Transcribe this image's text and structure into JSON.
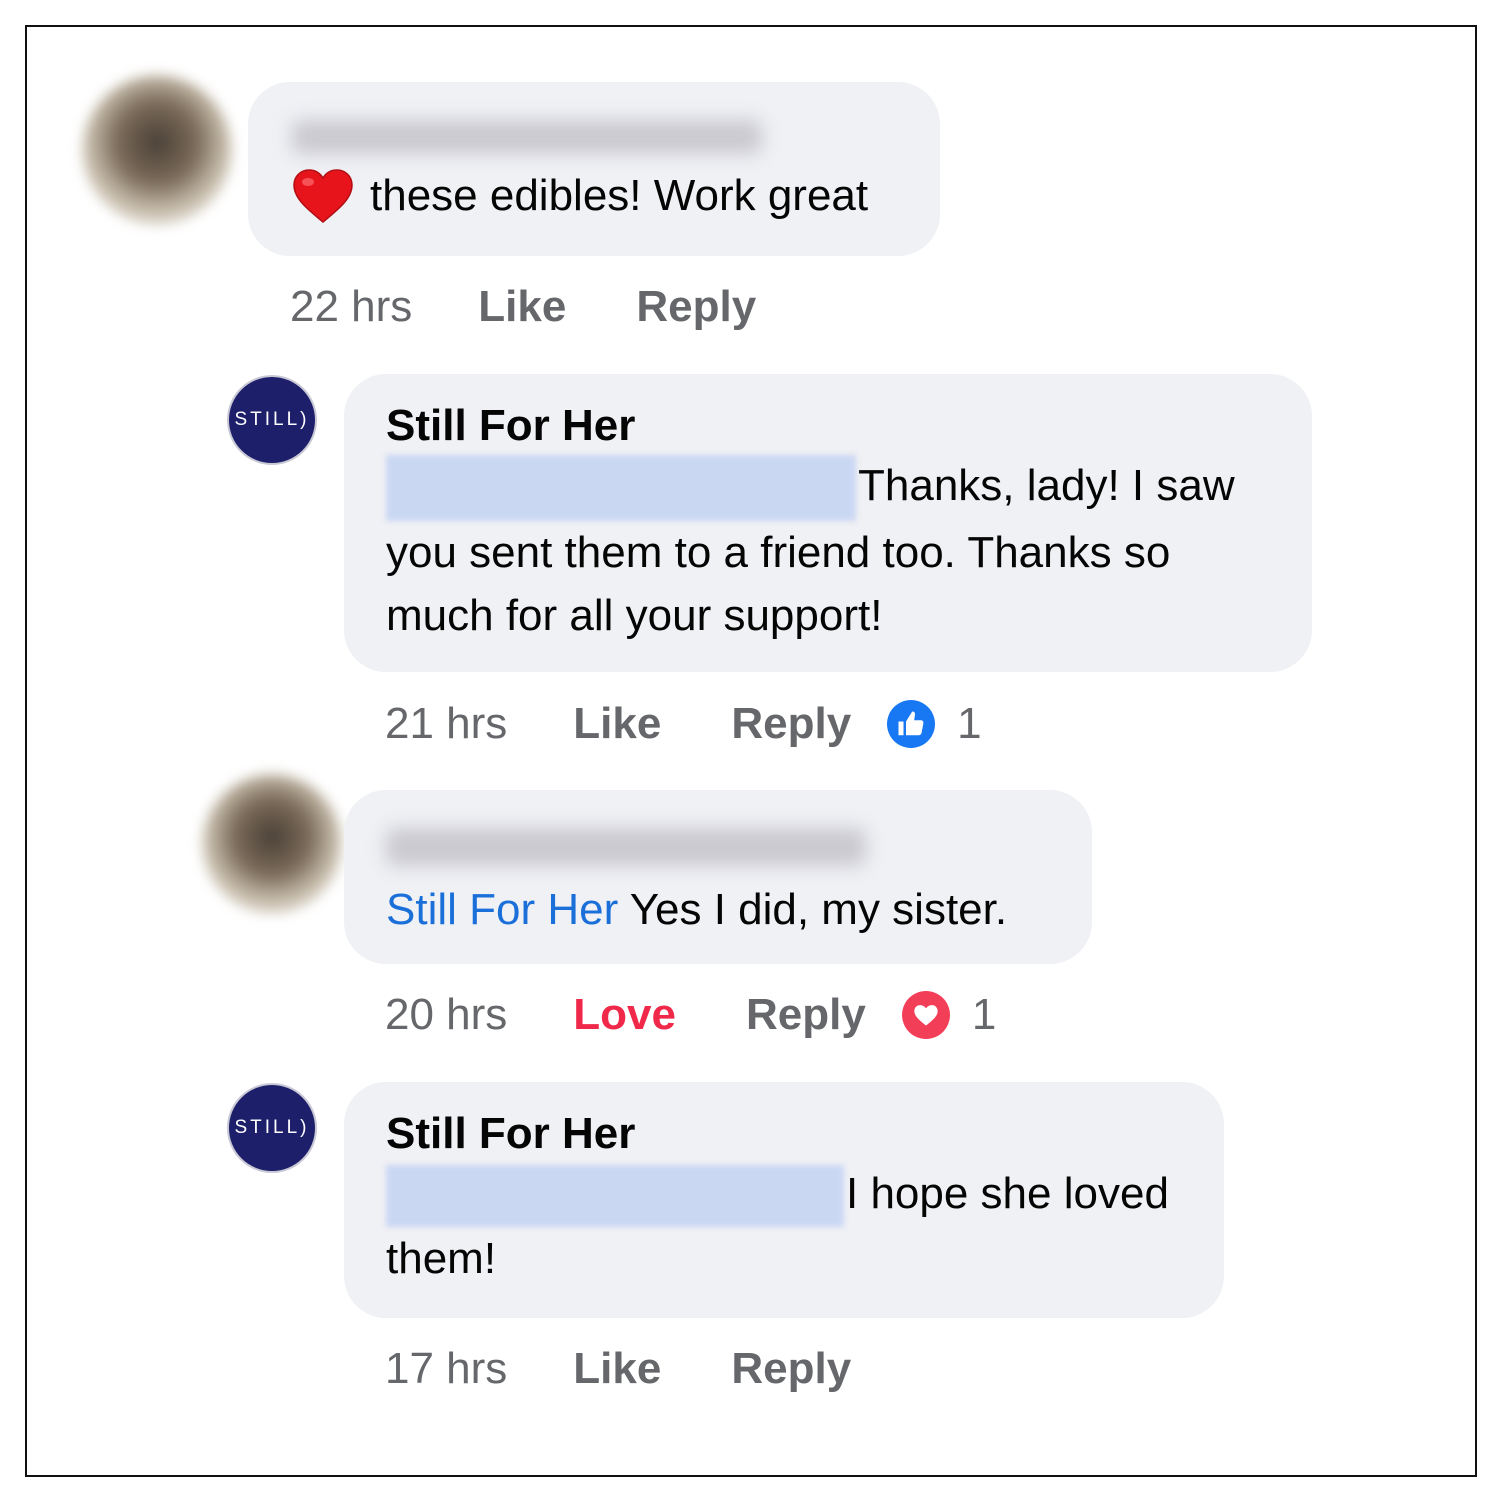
{
  "comments": [
    {
      "text_suffix": "these edibles! Work great",
      "time": "22 hrs",
      "like_label": "Like",
      "reply_label": "Reply"
    },
    {
      "author": "Still For Her",
      "avatar_text": "STILL)",
      "text": "Thanks, lady!  I saw you sent them to a friend too.  Thanks so much for all your support!",
      "time": "21 hrs",
      "like_label": "Like",
      "reply_label": "Reply",
      "reaction_count": "1"
    },
    {
      "mention": "Still For Her",
      "text": "Yes I did, my sister.",
      "time": "20 hrs",
      "like_label": "Love",
      "reply_label": "Reply",
      "reaction_count": "1"
    },
    {
      "author": "Still For Her",
      "avatar_text": "STILL)",
      "text": "I hope she loved them!",
      "time": "17 hrs",
      "like_label": "Like",
      "reply_label": "Reply"
    }
  ],
  "colors": {
    "bubble": "#f0f1f5",
    "link": "#1b6fd9",
    "love": "#f02849",
    "like_icon": "#1877f2",
    "meta": "#65676b"
  },
  "icons": {
    "heart_emoji": "red-heart-emoji-icon",
    "like_reaction": "thumbs-up-icon",
    "love_reaction": "heart-icon"
  }
}
